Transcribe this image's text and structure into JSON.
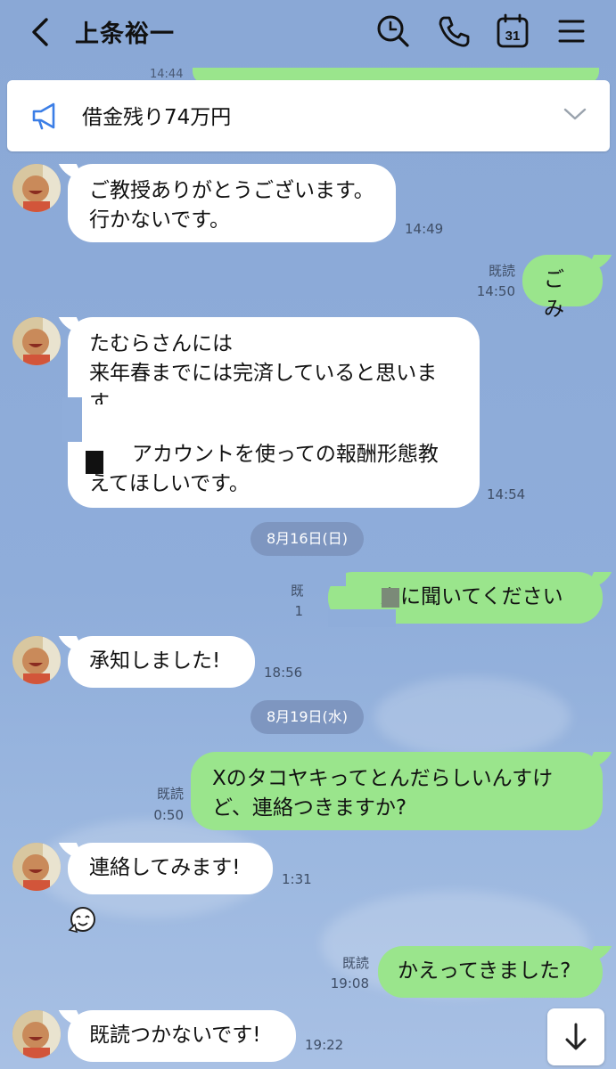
{
  "header": {
    "title": "上条裕一",
    "calendar_day": "31"
  },
  "partial_top": {
    "time": "14:44"
  },
  "announcement": {
    "text": "借金残り74万円"
  },
  "messages": [
    {
      "side": "in",
      "lines": [
        "ご教授ありがとうございます。",
        "行かないです。"
      ],
      "time": "14:49"
    },
    {
      "side": "out",
      "lines": [
        "ごみ"
      ],
      "read": "既読",
      "time": "14:50"
    },
    {
      "side": "in",
      "lines": [
        "たむらさんには",
        "来年春までには完済していると思いま",
        "す",
        "アカウントを使っての報酬形態教",
        "えてほしいです。"
      ],
      "time": "14:54"
    },
    {
      "side": "out",
      "lines": [
        "んに聞いてください"
      ],
      "read": "既",
      "time": "1"
    },
    {
      "side": "in",
      "lines": [
        "承知しました!"
      ],
      "time": "18:56"
    },
    {
      "side": "out",
      "lines": [
        "Xのタコヤキってとんだらしいんすけ",
        "ど、連絡つきますか?"
      ],
      "read": "既読",
      "time": "0:50"
    },
    {
      "side": "in",
      "lines": [
        "連絡してみます!"
      ],
      "time": "1:31"
    },
    {
      "side": "out",
      "lines": [
        "かえってきました?"
      ],
      "read": "既読",
      "time": "19:08"
    },
    {
      "side": "in",
      "lines": [
        "既読つかないです!"
      ],
      "time": "19:22"
    }
  ],
  "dates": [
    "8月16日(日)",
    "8月19日(水)"
  ],
  "colors": {
    "outgoing": "#9ae58c",
    "incoming": "#ffffff",
    "background": "#8fadda"
  }
}
